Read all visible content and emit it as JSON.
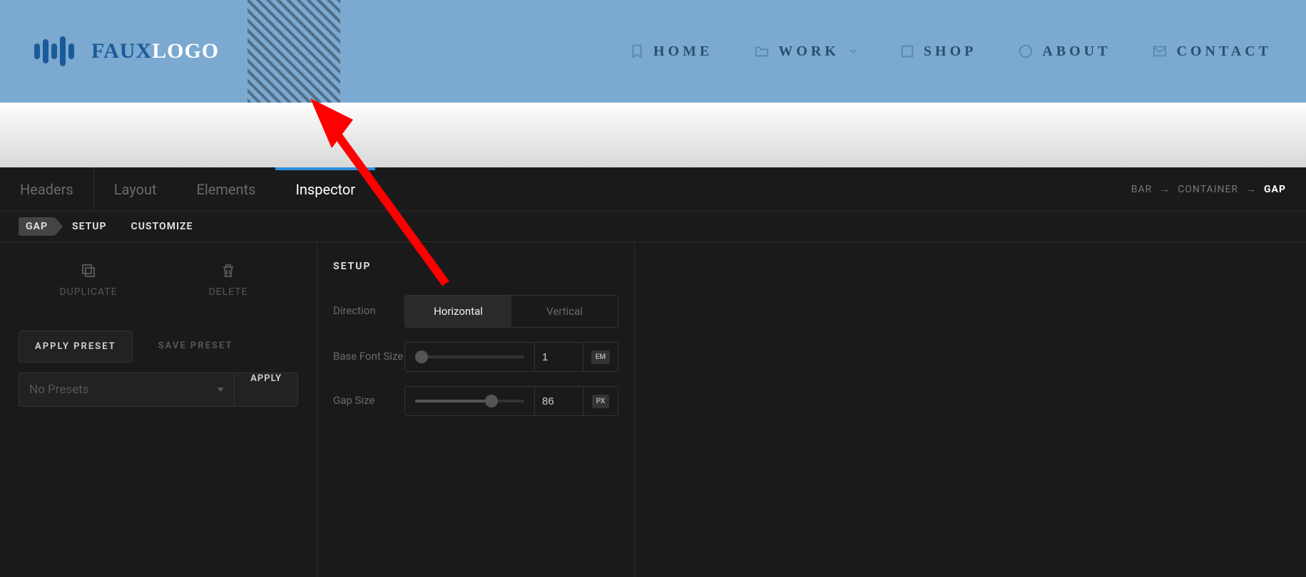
{
  "logo": {
    "prefix": "FAUX",
    "suffix": "LOGO"
  },
  "nav": [
    {
      "label": "HOME",
      "icon": "bookmark"
    },
    {
      "label": "WORK",
      "icon": "folder",
      "dropdown": true
    },
    {
      "label": "SHOP",
      "icon": "square"
    },
    {
      "label": "ABOUT",
      "icon": "circle"
    },
    {
      "label": "CONTACT",
      "icon": "envelope"
    }
  ],
  "tabs": [
    "Headers",
    "Layout",
    "Elements",
    "Inspector"
  ],
  "active_tab": "Inspector",
  "breadcrumb": [
    "BAR",
    "CONTAINER",
    "GAP"
  ],
  "subtabs": [
    "GAP",
    "SETUP",
    "CUSTOMIZE"
  ],
  "actions": {
    "duplicate": "DUPLICATE",
    "delete": "DELETE",
    "apply_preset": "APPLY PRESET",
    "save_preset": "SAVE PRESET",
    "no_presets": "No Presets",
    "apply": "APPLY"
  },
  "setup": {
    "title": "SETUP",
    "direction_label": "Direction",
    "direction_options": [
      "Horizontal",
      "Vertical"
    ],
    "direction_value": "Horizontal",
    "font_label": "Base Font Size",
    "font_value": "1",
    "font_unit": "EM",
    "gap_label": "Gap Size",
    "gap_value": "86",
    "gap_unit": "PX"
  }
}
